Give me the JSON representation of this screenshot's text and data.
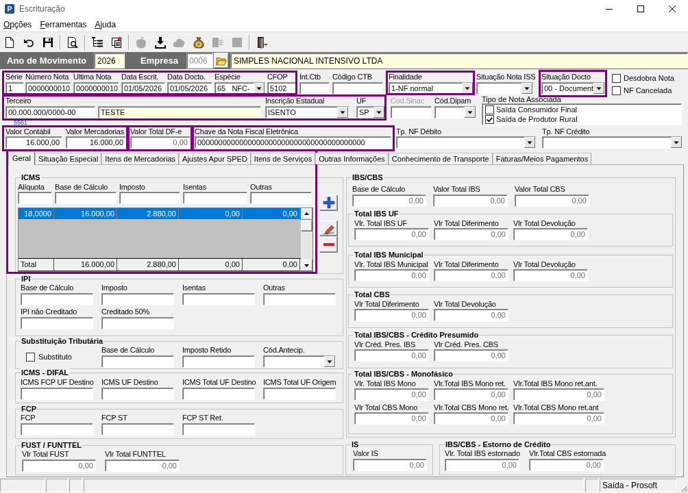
{
  "window": {
    "title": "Escrituração",
    "icon_letter": "P"
  },
  "menu": [
    "Opções",
    "Ferramentas",
    "Ajuda"
  ],
  "toolbar": [
    [
      {
        "disabled": false
      },
      {
        "disabled": false
      },
      {
        "disabled": false
      }
    ],
    [
      {
        "disabled": false
      }
    ],
    [
      {
        "disabled": false
      },
      {
        "disabled": false
      }
    ],
    [
      {
        "disabled": true
      },
      {
        "disabled": false
      },
      {
        "disabled": true
      },
      {
        "disabled": false
      },
      {
        "disabled": true
      },
      {
        "disabled": true
      }
    ],
    [
      {
        "disabled": false
      }
    ]
  ],
  "header": {
    "year": {
      "label": "Ano de Movimento",
      "value": "2026"
    },
    "company": {
      "label": "Empresa",
      "code": "0006",
      "code_disabled": true,
      "name": "SIMPLES NACIONAL INTENSIVO LTDA"
    }
  },
  "document": {
    "row_1": [
      {
        "label": "Série",
        "value": "1",
        "kind": "text"
      },
      {
        "label": "Número Nota",
        "value": "0000000010",
        "kind": "text"
      },
      {
        "label": "Ultima Nota",
        "value": "0000000010",
        "kind": "text"
      },
      {
        "label": "Data Escrit.",
        "value": "01/05/2026",
        "kind": "text"
      },
      {
        "label": "Data Docto.",
        "value": "01/05/2026",
        "kind": "text"
      },
      {
        "label": "Espécie",
        "value": "65   NFC-",
        "kind": "combo"
      },
      {
        "label": "CFOP",
        "value": "5102",
        "kind": "text"
      },
      {
        "label": "Int.Ctb",
        "kind": "text"
      },
      {
        "label": "Código CTB",
        "kind": "text"
      },
      {
        "label": "Finalidade",
        "value": "1-NF normal",
        "kind": "combo"
      },
      {
        "label": "Situação Nota ISS",
        "kind": "combo"
      },
      {
        "label": "Situação Docto",
        "value": "00 - Document",
        "kind": "combo"
      }
    ],
    "flags": [
      {
        "label": "Desdobra Nota",
        "checked": false
      },
      {
        "label": "NF Cancelada",
        "checked": false
      }
    ],
    "row_2": [
      {
        "label": "Terceiro",
        "value": "00.000.000/0000-00",
        "kind": "text",
        "disabled": false,
        "display_only": false
      },
      {
        "value": "TESTE",
        "kind": "text",
        "disabled": false,
        "display_only": true
      },
      {
        "label": "Inscrição Estadual",
        "value": "ISENTO",
        "kind": "combo",
        "disabled": false,
        "display_only": false
      },
      {
        "label": "UF",
        "value": "SP",
        "kind": "combo",
        "disabled": false,
        "display_only": false
      },
      {
        "label": "Cod.Sinac",
        "kind": "text",
        "disabled": true,
        "display_only": false
      },
      {
        "label": "Cód.Dipam",
        "kind": "combo",
        "disabled": false,
        "display_only": false
      }
    ],
    "terceiro_link": "5561",
    "nota_associada": {
      "label": "Tipo de Nota Associada",
      "options": [
        {
          "label": "Saída Consumidor Final",
          "checked": false
        },
        {
          "label": "Saída de Produtor Rural",
          "checked": true
        }
      ]
    },
    "row_3": [
      {
        "label": "Valor Contábil",
        "value": "16.000,00",
        "kind": "number",
        "readonly": false
      },
      {
        "label": "Valor Mercadorias",
        "value": "16.000,00",
        "kind": "number",
        "readonly": false
      },
      {
        "label": "Valor Total DF-e",
        "value": "0,00",
        "kind": "number",
        "readonly": true
      },
      {
        "label": "Chave da Nota Fiscal Eletrônica",
        "value": "0000000000000000000000000000000000000000",
        "kind": "text",
        "readonly": false
      },
      {
        "label": "Tp. NF Débito",
        "kind": "combo"
      },
      {
        "label": "Tp. NF Crédito",
        "kind": "combo"
      }
    ]
  },
  "tabs": [
    {
      "label": "Geral",
      "selected": true
    },
    {
      "label": "Situação Especial",
      "selected": false
    },
    {
      "label": "Itens de Mercadorias",
      "selected": false
    },
    {
      "label": "Ajustes Apur SPED",
      "selected": false
    },
    {
      "label": "Itens de Serviços",
      "selected": false
    },
    {
      "label": "Outras Informações",
      "selected": false
    },
    {
      "label": "Conhecimento de Transporte",
      "selected": false
    },
    {
      "label": "Faturas/Meios Pagamentos",
      "selected": false
    }
  ],
  "tab_content": {
    "icms": {
      "title": "ICMS",
      "fields": [
        {
          "label": "Alíquota",
          "kind": "text"
        },
        {
          "label": "Base de Cálculo",
          "kind": "text"
        },
        {
          "label": "Imposto",
          "kind": "text"
        },
        {
          "label": "Isentas",
          "kind": "text"
        },
        {
          "label": "Outras",
          "kind": "text"
        }
      ],
      "grid": {
        "rows": [
          {
            "cells": [
              "18,0000",
              "16.000,00",
              "2.880,00",
              "0,00",
              "0,00"
            ],
            "selected": true
          }
        ],
        "total": [
          "Total",
          "16.000,00",
          "2.880,00",
          "0,00",
          "0,00"
        ]
      }
    },
    "left_groups": [
      {
        "title": "IPI",
        "rows": [
          [
            {
              "label": "Base de Cálculo",
              "kind": "text"
            },
            {
              "label": "Imposto",
              "kind": "text"
            },
            {
              "label": "Isentas",
              "kind": "text"
            },
            {
              "label": "Outras",
              "kind": "text"
            }
          ],
          [
            {
              "label": "IPI não Creditado",
              "kind": "text"
            },
            {
              "label": "Creditado 50%",
              "kind": "text"
            }
          ]
        ]
      },
      {
        "title": "Substituição Tributária",
        "rows": [
          [
            {
              "label": "Substituto",
              "kind": "check",
              "checked": false
            },
            {
              "label": "Base de Cálculo",
              "kind": "text"
            },
            {
              "label": "Imposto Retido",
              "kind": "text"
            },
            {
              "label": "Cód.Antecip.",
              "kind": "combo"
            }
          ]
        ]
      },
      {
        "title": "ICMS - DIFAL",
        "rows": [
          [
            {
              "label": "ICMS FCP UF Destino",
              "kind": "text"
            },
            {
              "label": "ICMS UF Destino",
              "kind": "text"
            },
            {
              "label": "ICMS Total UF Destino",
              "kind": "text"
            },
            {
              "label": "ICMS Total UF Origem",
              "kind": "text"
            }
          ]
        ]
      },
      {
        "title": "FCP",
        "rows": [
          [
            {
              "label": "FCP",
              "kind": "text"
            },
            {
              "label": "FCP ST",
              "kind": "text"
            },
            {
              "label": "FCP ST Ret.",
              "kind": "text"
            }
          ]
        ]
      },
      {
        "title": "FUST / FUNTTEL",
        "rows": [
          [
            {
              "label": "Vlr Total FUST",
              "value": "0,00",
              "kind": "number",
              "readonly": true
            },
            {
              "label": "Vlr Total FUNTTEL",
              "value": "0,00",
              "kind": "number",
              "readonly": true
            }
          ]
        ]
      }
    ],
    "ibs_cbs": {
      "title": "IBS/CBS",
      "fields": [
        {
          "label": "Base de Cálculo",
          "value": "0,00",
          "kind": "number",
          "readonly": true
        },
        {
          "label": "Valor Total IBS",
          "value": "0,00",
          "kind": "number",
          "readonly": true
        },
        {
          "label": "Valor Total CBS",
          "value": "0,00",
          "kind": "number",
          "readonly": true
        }
      ],
      "groups": [
        {
          "title": "Total IBS UF",
          "rows": [
            [
              {
                "label": "Vlr. Total IBS UF",
                "value": "0,00",
                "kind": "number",
                "readonly": true
              },
              {
                "label": "Vlr Total Diferimento",
                "value": "0,00",
                "kind": "number",
                "readonly": true
              },
              {
                "label": "Vlr Total Devolução",
                "value": "0,00",
                "kind": "number",
                "readonly": true
              }
            ]
          ]
        },
        {
          "title": "Total IBS Municipal",
          "rows": [
            [
              {
                "label": "Vlr. Total IBS Municipal",
                "value": "0,00",
                "kind": "number",
                "readonly": true
              },
              {
                "label": "Vlr Total Diferimento",
                "value": "0,00",
                "kind": "number",
                "readonly": true
              },
              {
                "label": "Vlr Total Devolução",
                "value": "0,00",
                "kind": "number",
                "readonly": true
              }
            ]
          ]
        },
        {
          "title": "Total CBS",
          "rows": [
            [
              {
                "label": "Vlr Total Diferimento",
                "value": "0,00",
                "kind": "number",
                "readonly": true
              },
              {
                "label": "Vlr Total Devolução",
                "value": "0,00",
                "kind": "number",
                "readonly": true
              }
            ]
          ]
        },
        {
          "title": "Total IBS/CBS - Crédito Presumido",
          "rows": [
            [
              {
                "label": "Vlr Créd. Pres. IBS",
                "value": "0,00",
                "kind": "number",
                "readonly": true
              },
              {
                "label": "Vlr Créd. Pres. CBS",
                "value": "0,00",
                "kind": "number",
                "readonly": true
              }
            ]
          ]
        },
        {
          "title": "Total IBS/CBS - Monofásico",
          "rows": [
            [
              {
                "label": "Vlr. Total IBS Mono",
                "value": "0,00",
                "kind": "number",
                "readonly": true
              },
              {
                "label": "Vlr.Total IBS Mono ret.",
                "value": "0,00",
                "kind": "number",
                "readonly": true
              },
              {
                "label": "Vlr.Total IBS Mono ret.ant.",
                "value": "0,00",
                "kind": "number",
                "readonly": true
              }
            ],
            [
              {
                "label": "Vlr Total CBS Mono",
                "value": "0,00",
                "kind": "number",
                "readonly": true
              },
              {
                "label": "Vlr.Total CBS Mono ret.",
                "value": "0,00",
                "kind": "number",
                "readonly": true
              },
              {
                "label": "Vlr.Total CBS Mono ret.ant",
                "value": "0,00",
                "kind": "number",
                "readonly": true
              }
            ]
          ]
        }
      ]
    },
    "is": {
      "title": "IS",
      "fields": [
        {
          "label": "Valor IS",
          "value": "0,00",
          "kind": "number",
          "readonly": true
        }
      ]
    },
    "estorno": {
      "title": "IBS/CBS - Estorno de Crédito",
      "fields": [
        {
          "label": "Vlr. Total IBS estornado",
          "value": "0,00",
          "kind": "number",
          "readonly": true
        },
        {
          "label": "Vlr.Total CBS estornada",
          "value": "0,00",
          "kind": "number",
          "readonly": true
        }
      ]
    }
  },
  "status_bar": {
    "text": "Saída - Prosoft"
  }
}
